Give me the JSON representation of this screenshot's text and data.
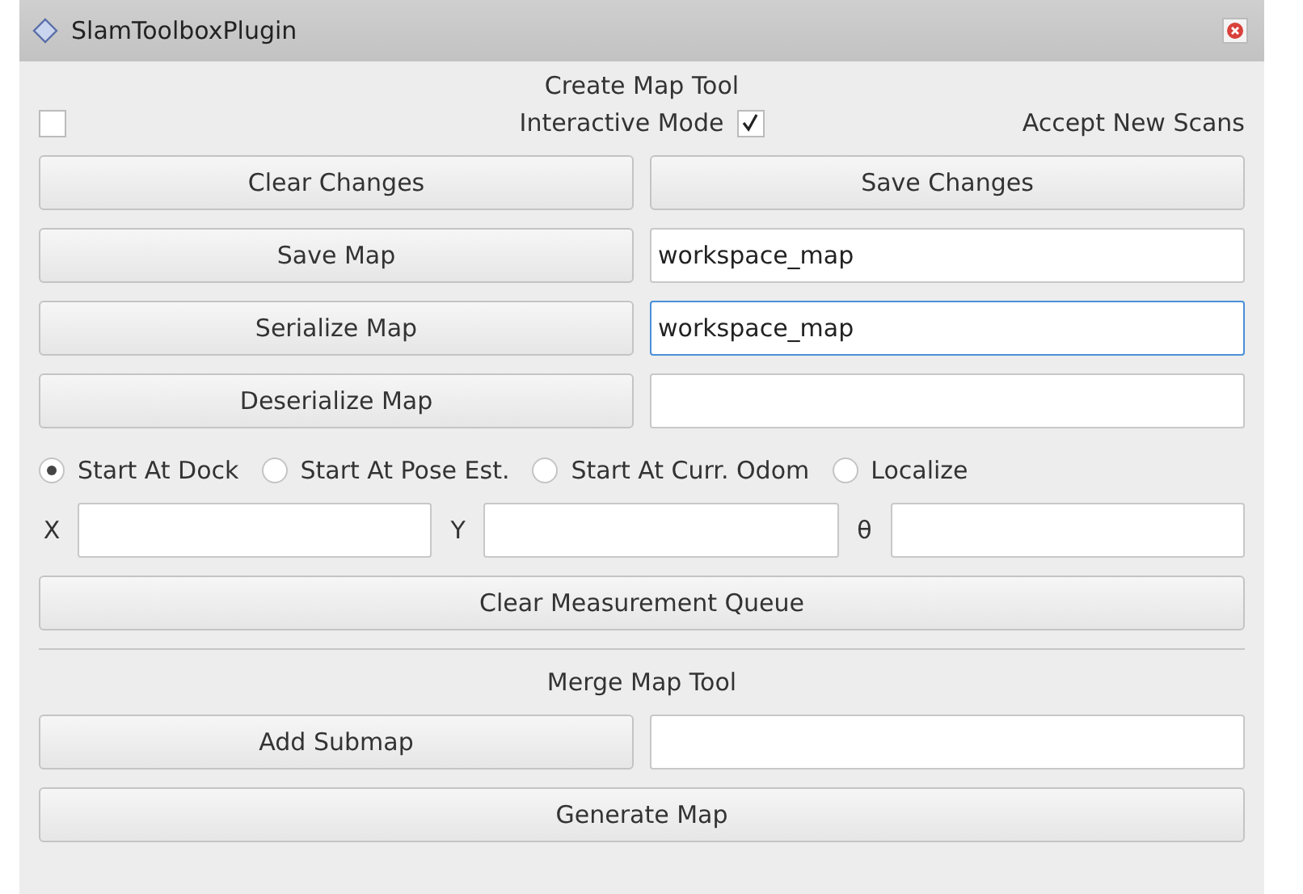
{
  "window": {
    "title": "SlamToolboxPlugin"
  },
  "create_map_tool": {
    "heading": "Create Map Tool",
    "toggles": [
      {
        "kind": "checkbox",
        "checked": false
      },
      {
        "kind": "label",
        "text": "Interactive Mode"
      },
      {
        "kind": "checkbox",
        "checked": true
      },
      {
        "kind": "label",
        "text": "Accept New Scans"
      }
    ],
    "rows": [
      {
        "kind": "buttons",
        "buttons": [
          "Clear Changes",
          "Save Changes"
        ]
      },
      {
        "kind": "button_field",
        "button": "Save Map",
        "value": "workspace_map",
        "focused": false
      },
      {
        "kind": "button_field",
        "button": "Serialize Map",
        "value": "workspace_map",
        "focused": true
      },
      {
        "kind": "button_field",
        "button": "Deserialize Map",
        "value": "",
        "focused": false
      }
    ],
    "start_modes": [
      {
        "label": "Start At Dock",
        "selected": true
      },
      {
        "label": "Start At Pose Est.",
        "selected": false
      },
      {
        "label": "Start At Curr. Odom",
        "selected": false
      },
      {
        "label": "Localize",
        "selected": false
      }
    ],
    "pose_fields": [
      {
        "label": "X"
      },
      {
        "label": "Y"
      },
      {
        "label": "θ"
      }
    ],
    "clear_button": "Clear Measurement Queue"
  },
  "merge_map_tool": {
    "heading": "Merge Map Tool",
    "rows": [
      {
        "kind": "button_field",
        "button": "Add Submap",
        "value": "",
        "focused": false
      },
      {
        "kind": "button",
        "button": "Generate Map"
      }
    ]
  }
}
